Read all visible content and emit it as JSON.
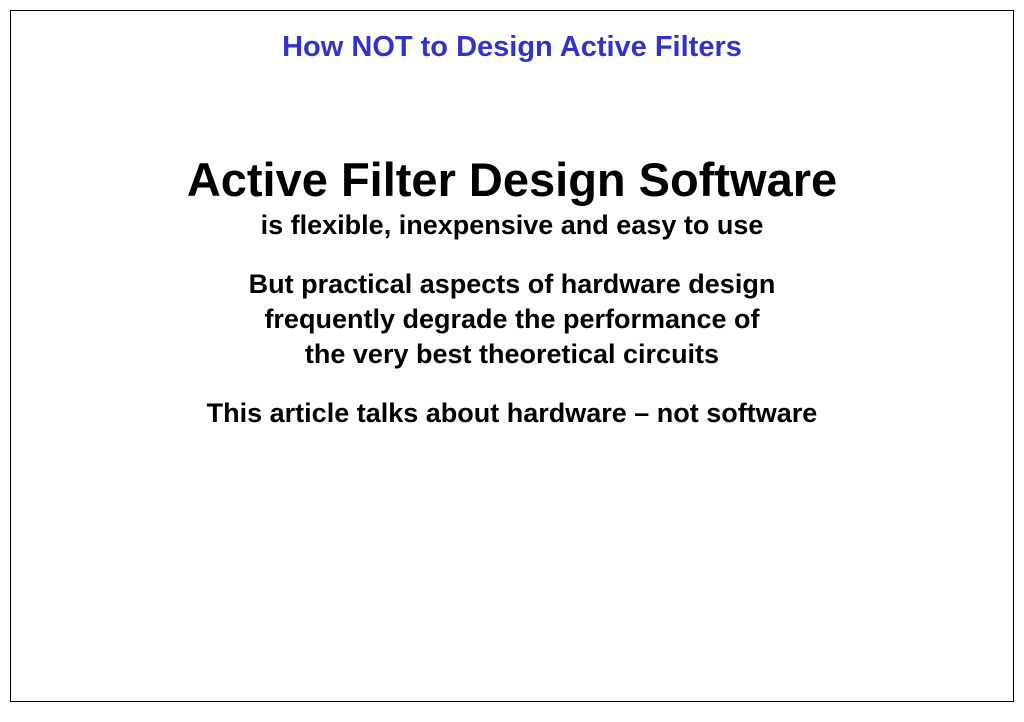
{
  "slide": {
    "header": "How NOT to Design Active Filters",
    "main_heading": "Active Filter Design Software",
    "subtitle": "is flexible, inexpensive and easy to use",
    "body_line1": "But practical aspects of hardware design",
    "body_line2": "frequently degrade the performance of",
    "body_line3": "the very best theoretical circuits",
    "closing": "This article talks about hardware – not software"
  }
}
